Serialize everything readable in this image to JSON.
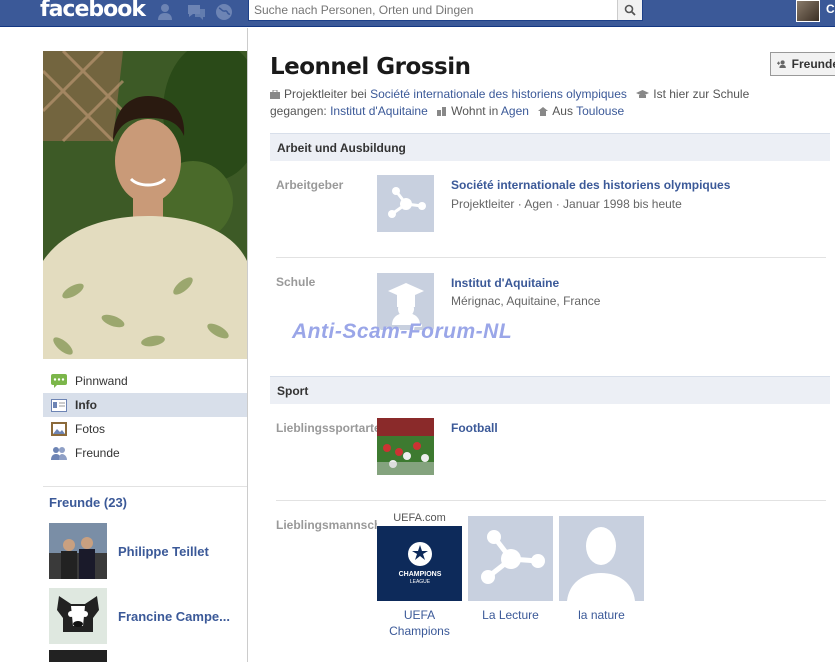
{
  "topbar": {
    "logo": "facebook",
    "search_placeholder": "Suche nach Personen, Orten und Dingen",
    "user_initial": "C"
  },
  "profile": {
    "name": "Leonnel Grossin",
    "friend_button": "Freunde",
    "work_prefix": "Projektleiter bei",
    "work_link": "Société internationale des historiens olympiques",
    "school_prefix": "Ist hier zur Schule",
    "school_prefix2": "gegangen:",
    "school_link": "Institut d'Aquitaine",
    "lives_prefix": "Wohnt in",
    "lives_link": "Agen",
    "from_prefix": "Aus",
    "from_link": "Toulouse"
  },
  "nav": {
    "items": [
      {
        "label": "Pinnwand"
      },
      {
        "label": "Info"
      },
      {
        "label": "Fotos"
      },
      {
        "label": "Freunde"
      }
    ]
  },
  "friends": {
    "heading": "Freunde (23)",
    "list": [
      {
        "name": "Philippe Teillet"
      },
      {
        "name": "Francine Campe..."
      }
    ]
  },
  "sections": {
    "work_edu": {
      "heading": "Arbeit und Ausbildung",
      "employer_label": "Arbeitgeber",
      "employer_title": "Société internationale des historiens olympiques",
      "employer_sub": "Projektleiter · Agen · Januar 1998 bis heute",
      "school_label": "Schule",
      "school_title": "Institut d'Aquitaine",
      "school_sub": "Mérignac, Aquitaine, France"
    },
    "sport": {
      "heading": "Sport",
      "fav_sport_label": "Lieblingssportarten",
      "fav_sport_title": "Football",
      "fav_teams_label": "Lieblingsmannschaften",
      "teams": [
        {
          "caption1": "UEFA",
          "caption2": "Champions",
          "brand": "UEFA.com"
        },
        {
          "caption1": "La Lecture",
          "caption2": ""
        },
        {
          "caption1": "la nature",
          "caption2": ""
        }
      ]
    }
  },
  "watermark": "Anti-Scam-Forum-NL",
  "colors": {
    "fb_blue": "#3b5998",
    "section_bg": "#eceff5",
    "active_nav": "#d8dfea",
    "watermark": "#9aa6e8"
  }
}
